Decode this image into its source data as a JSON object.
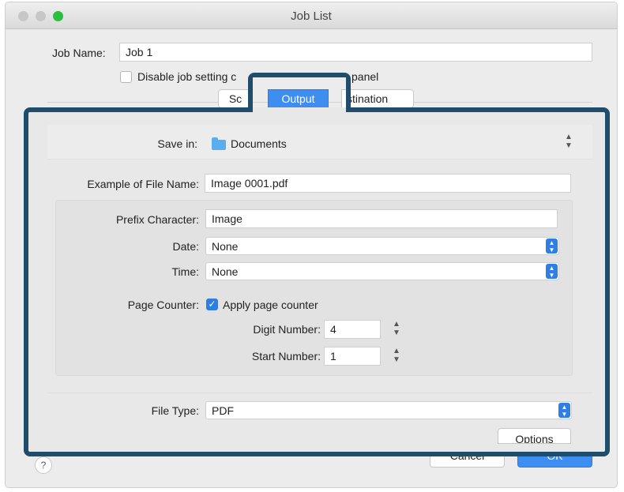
{
  "window": {
    "title": "Job List"
  },
  "job": {
    "name_label": "Job Name:",
    "name_value": "Job 1",
    "disable_label": "Disable job setting c",
    "disable_label_tail": "panel"
  },
  "tabs": [
    {
      "label": "Sc"
    },
    {
      "label": "Output"
    },
    {
      "label": "stination"
    }
  ],
  "output": {
    "save_in_label": "Save in:",
    "save_in_value": "Documents",
    "example_label": "Example of File Name:",
    "example_value": "Image 0001.pdf",
    "prefix_label": "Prefix Character:",
    "prefix_value": "Image",
    "date_label": "Date:",
    "date_value": "None",
    "time_label": "Time:",
    "time_value": "None",
    "page_counter_label": "Page Counter:",
    "apply_counter_label": "Apply page counter",
    "digit_label": "Digit Number:",
    "digit_value": "4",
    "start_label": "Start Number:",
    "start_value": "1",
    "file_type_label": "File Type:",
    "file_type_value": "PDF",
    "options_label": "Options"
  },
  "footer": {
    "cancel_label": "Cancel",
    "ok_label": "OK",
    "help_label": "?"
  },
  "colors": {
    "highlight": "#1f4d6b",
    "accent": "#3d8ef0"
  }
}
